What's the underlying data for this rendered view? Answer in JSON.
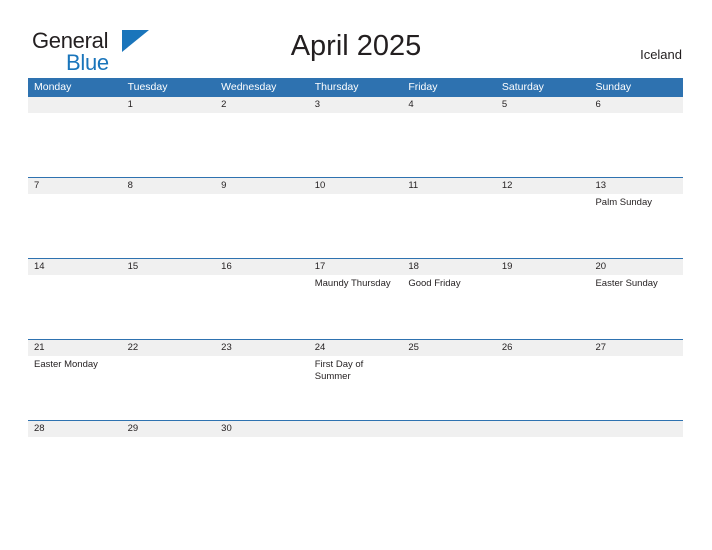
{
  "brand": {
    "name_part1": "General",
    "name_part2": "Blue",
    "flag_icon": "blue-triangle-flag",
    "accent_color": "#1a75bb"
  },
  "header": {
    "title": "April 2025",
    "country": "Iceland"
  },
  "colors": {
    "header_blue": "#2e72b0",
    "date_band_gray": "#f0f0f0",
    "text_dark": "#231f20",
    "brand_blue": "#1a75bb"
  },
  "calendar": {
    "month": "April",
    "year": "2025",
    "weekdays": [
      "Monday",
      "Tuesday",
      "Wednesday",
      "Thursday",
      "Friday",
      "Saturday",
      "Sunday"
    ],
    "weeks": [
      [
        {
          "day": "",
          "event": ""
        },
        {
          "day": "1",
          "event": ""
        },
        {
          "day": "2",
          "event": ""
        },
        {
          "day": "3",
          "event": ""
        },
        {
          "day": "4",
          "event": ""
        },
        {
          "day": "5",
          "event": ""
        },
        {
          "day": "6",
          "event": ""
        }
      ],
      [
        {
          "day": "7",
          "event": ""
        },
        {
          "day": "8",
          "event": ""
        },
        {
          "day": "9",
          "event": ""
        },
        {
          "day": "10",
          "event": ""
        },
        {
          "day": "11",
          "event": ""
        },
        {
          "day": "12",
          "event": ""
        },
        {
          "day": "13",
          "event": "Palm Sunday"
        }
      ],
      [
        {
          "day": "14",
          "event": ""
        },
        {
          "day": "15",
          "event": ""
        },
        {
          "day": "16",
          "event": ""
        },
        {
          "day": "17",
          "event": "Maundy Thursday"
        },
        {
          "day": "18",
          "event": "Good Friday"
        },
        {
          "day": "19",
          "event": ""
        },
        {
          "day": "20",
          "event": "Easter Sunday"
        }
      ],
      [
        {
          "day": "21",
          "event": "Easter Monday"
        },
        {
          "day": "22",
          "event": ""
        },
        {
          "day": "23",
          "event": ""
        },
        {
          "day": "24",
          "event": "First Day of Summer"
        },
        {
          "day": "25",
          "event": ""
        },
        {
          "day": "26",
          "event": ""
        },
        {
          "day": "27",
          "event": ""
        }
      ],
      [
        {
          "day": "28",
          "event": ""
        },
        {
          "day": "29",
          "event": ""
        },
        {
          "day": "30",
          "event": ""
        },
        {
          "day": "",
          "event": ""
        },
        {
          "day": "",
          "event": ""
        },
        {
          "day": "",
          "event": ""
        },
        {
          "day": "",
          "event": ""
        }
      ]
    ]
  }
}
